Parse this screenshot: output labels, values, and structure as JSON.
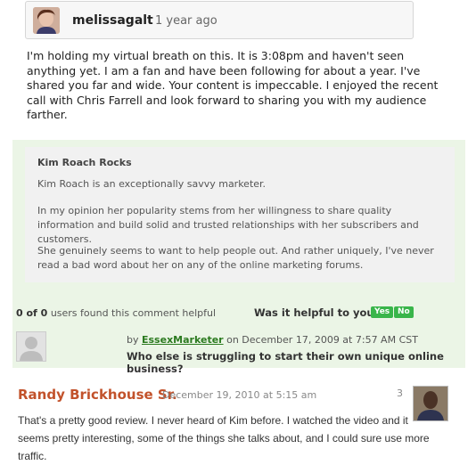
{
  "top_comment": {
    "username": "melissagalt",
    "time": "1 year ago",
    "text": "I'm holding my virtual breath on this. It is 3:08pm and haven't seen anything yet. I am a fan and have been following for about a year. I've shared you far and wide. Your content is impeccable. I enjoyed the recent call with Chris Farrell and look forward to sharing you with my audience farther."
  },
  "review": {
    "title": "Kim Roach Rocks",
    "paragraphs": [
      "Kim Roach is an exceptionally savvy marketer.",
      "In my opinion her popularity stems from her willingness to share quality information and build solid and trusted relationships with her subscribers and customers.",
      "She genuinely seems to want to help people out. And rather uniquely, I've never read a bad word about her on any of the online marketing forums."
    ]
  },
  "helpful": {
    "count_found": "0 of 0",
    "count_suffix": "users found this comment helpful",
    "question": "Was it helpful to you?",
    "yes_label": "Yes",
    "no_label": "No",
    "by_prefix": "by",
    "by_user": "EssexMarketer",
    "by_date": "on December 17, 2009 at 7:57 AM CST",
    "review_title": "Who else is struggling to start their own unique online business?"
  },
  "bottom_comment": {
    "name": "Randy Brickhouse Sr.",
    "date": "December 19, 2010 at 5:15 am",
    "number": "3",
    "text": "That's a pretty good review. I never heard of Kim before. I watched the video and it seems pretty interesting, some of the things she talks about, and I could sure use more traffic."
  }
}
